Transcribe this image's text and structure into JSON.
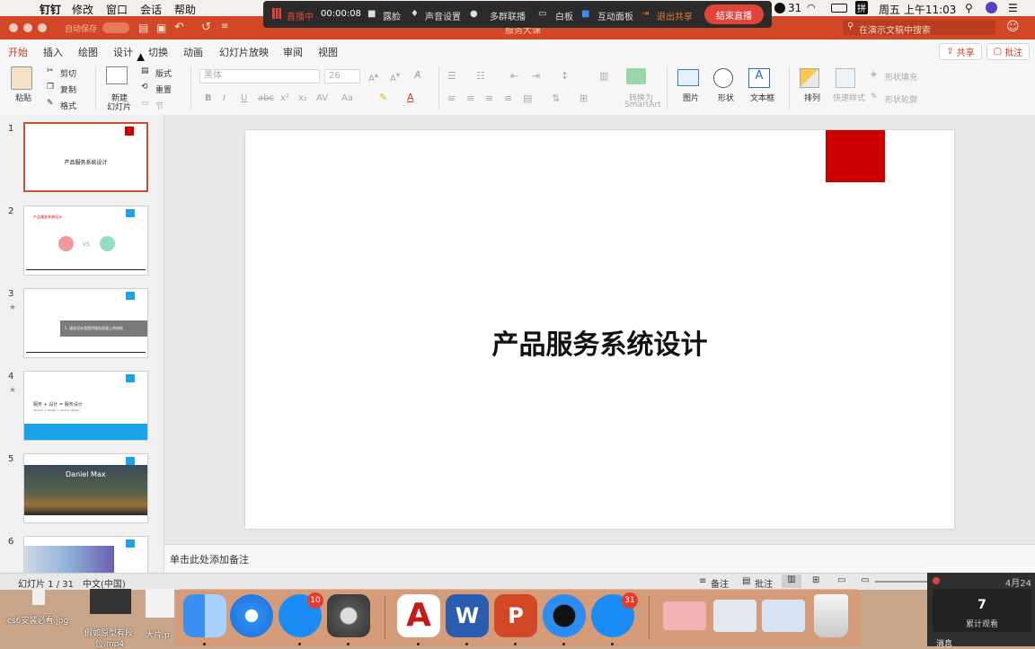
{
  "menubar": {
    "app": "钉钉",
    "items": [
      "修改",
      "窗口",
      "会话",
      "帮助"
    ],
    "status_num": "31",
    "ime": "拼",
    "clock": "周五 上午11:03"
  },
  "titlebar": {
    "autosave": "自动保存",
    "doc_title": "服务大课",
    "search_placeholder": "在演示文稿中搜索"
  },
  "livebar": {
    "live_label": "直播中",
    "timer": "00:00:08",
    "camera": "露脸",
    "mic": "声音设置",
    "multi": "多群联播",
    "whiteboard": "白板",
    "interact": "互动面板",
    "exit_share": "退出共享",
    "end_live": "结束直播"
  },
  "ribbon_tabs": [
    "开始",
    "插入",
    "绘图",
    "设计",
    "切换",
    "动画",
    "幻灯片放映",
    "审阅",
    "视图"
  ],
  "share_label": "共享",
  "comment_label": "批注",
  "ribbon": {
    "paste": "粘贴",
    "cut": "剪切",
    "copy": "复制",
    "format": "格式",
    "new_slide_1": "新建",
    "new_slide_2": "幻灯片",
    "layout": "版式",
    "reset": "重置",
    "section": "节",
    "font_name": "黑体",
    "font_size": "26",
    "convert_1": "转换为",
    "convert_2": "SmartArt",
    "picture": "图片",
    "shape": "形状",
    "textbox": "文本框",
    "arrange": "排列",
    "quick_styles": "快速样式",
    "shape_fill": "形状填充",
    "shape_outline": "形状轮廓"
  },
  "slides": [
    {
      "num": "1",
      "title": "产品服务系统设计"
    },
    {
      "num": "2",
      "title": "产品服务系统设计",
      "vs": "VS"
    },
    {
      "num": "3",
      "title": "1. 服务设计是提供服务质量上的创新"
    },
    {
      "num": "4",
      "title": "服务 + 设计 = 服务设计",
      "subtitle": "Service + design = service design"
    },
    {
      "num": "5",
      "title": "Daniel  Max"
    },
    {
      "num": "6"
    }
  ],
  "main_slide_title": "产品服务系统设计",
  "notes_placeholder": "单击此处添加备注",
  "statusbar": {
    "slide_info": "幻灯片 1 / 31",
    "language": "中文(中国)",
    "notes": "备注",
    "comments": "批注"
  },
  "desktop_files": [
    "cs6安装必看.jpg",
    "假如原型有段",
    "位.mp4",
    "大片.p"
  ],
  "dock_badges": {
    "appstore": "10",
    "dingtalk": "31"
  },
  "view_panel": {
    "date": "4月24",
    "count": "7",
    "label": "累计观看",
    "msg": "消息"
  },
  "colors": {
    "accent": "#d24726",
    "slide_red": "#cc0000",
    "thumb_blue": "#1aa3e8",
    "live_red": "#e2443a"
  }
}
